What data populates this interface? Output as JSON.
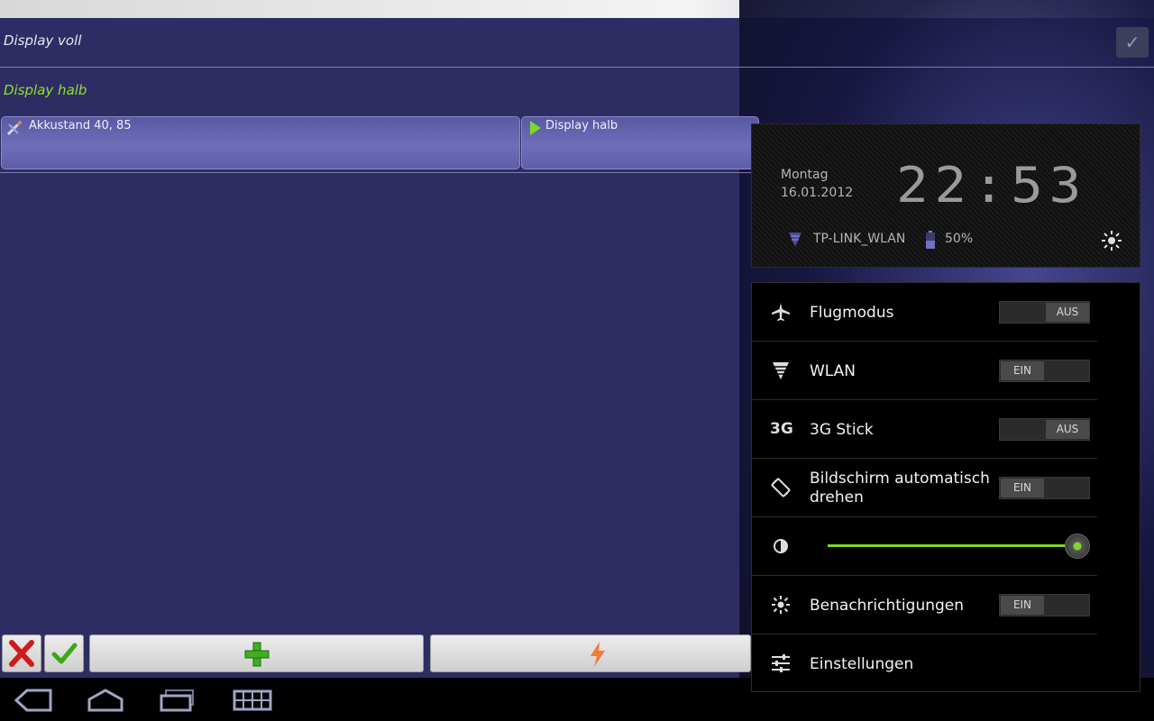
{
  "rules": {
    "row1_label": "Display voll",
    "row2_label": "Display halb"
  },
  "conditions": {
    "left_label": "Akkustand 40, 85",
    "right_label": "Display halb"
  },
  "clock": {
    "weekday": "Montag",
    "date": "16.01.2012",
    "time": "22:53",
    "wifi_name": "TP-LINK_WLAN",
    "battery": "50%"
  },
  "settings": {
    "airplane": {
      "label": "Flugmodus",
      "state": "AUS"
    },
    "wlan": {
      "label": "WLAN",
      "state": "EIN"
    },
    "stick3g": {
      "icon_text": "3G",
      "label": "3G Stick",
      "state": "AUS"
    },
    "rotate": {
      "label_line1": "Bildschirm automatisch",
      "label_line2": "drehen",
      "state": "EIN"
    },
    "brightness": {
      "level": 1.0
    },
    "notifications": {
      "label": "Benachrichtigungen",
      "state": "EIN"
    },
    "settings_link": {
      "label": "Einstellungen"
    }
  },
  "colors": {
    "accent_green": "#8fe12b",
    "background": "#2e2d63"
  },
  "icons": [
    "airplane-icon",
    "wifi-icon",
    "rotate-icon",
    "brightness-icon",
    "notification-icon",
    "settings-icon",
    "back-icon",
    "home-icon",
    "recent-apps-icon",
    "keyboard-icon"
  ]
}
